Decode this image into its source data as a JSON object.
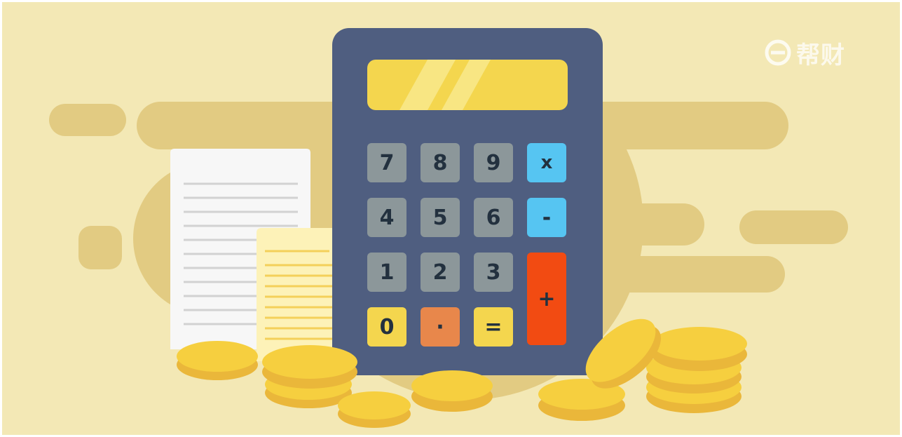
{
  "watermark": {
    "text": "帮财",
    "mark_icon": "e-logo-icon"
  },
  "calculator": {
    "keys": [
      {
        "label": "7",
        "kind": "digit"
      },
      {
        "label": "8",
        "kind": "digit"
      },
      {
        "label": "9",
        "kind": "digit"
      },
      {
        "label": "x",
        "kind": "operator"
      },
      {
        "label": "4",
        "kind": "digit"
      },
      {
        "label": "5",
        "kind": "digit"
      },
      {
        "label": "6",
        "kind": "digit"
      },
      {
        "label": "-",
        "kind": "operator"
      },
      {
        "label": "1",
        "kind": "digit"
      },
      {
        "label": "2",
        "kind": "digit"
      },
      {
        "label": "3",
        "kind": "digit"
      },
      {
        "label": "+",
        "kind": "plus"
      },
      {
        "label": "0",
        "kind": "zero"
      },
      {
        "label": "·",
        "kind": "dot"
      },
      {
        "label": "=",
        "kind": "equals"
      }
    ]
  },
  "colors": {
    "background": "#f3e8b5",
    "blob": "#e2cb82",
    "calculator_body": "#4f5e80",
    "display": "#f4d64e",
    "digit_key": "#8c979a",
    "operator_key": "#56c5f2",
    "plus_key": "#f24b12",
    "zero_key": "#f4d64e",
    "dot_key": "#e8874b",
    "equals_key": "#f4d64e",
    "coin": "#f6cf3f",
    "coin_edge": "#eab73a",
    "receipt_white": "#f7f7f7",
    "receipt_yellow": "#fdf2b8"
  }
}
